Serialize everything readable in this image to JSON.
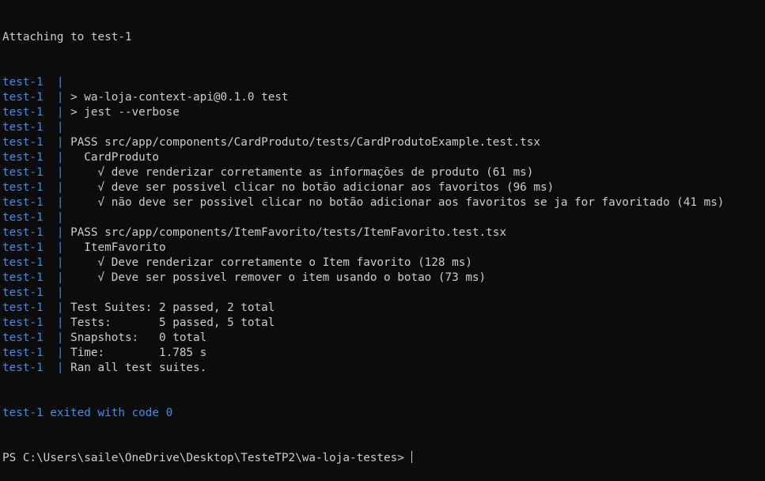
{
  "terminal": {
    "attach_line": "Attaching to test-1",
    "prefix": "test-1",
    "separator": "|",
    "lines": [
      "",
      "> wa-loja-context-api@0.1.0 test",
      "> jest --verbose",
      "",
      "PASS src/app/components/CardProduto/tests/CardProdutoExample.test.tsx",
      "  CardProduto",
      "    √ deve renderizar corretamente as informações de produto (61 ms)",
      "    √ deve ser possivel clicar no botão adicionar aos favoritos (96 ms)",
      "    √ não deve ser possivel clicar no botão adicionar aos favoritos se ja for favoritado (41 ms)",
      "",
      "PASS src/app/components/ItemFavorito/tests/ItemFavorito.test.tsx",
      "  ItemFavorito",
      "    √ Deve renderizar corretamente o Item favorito (128 ms)",
      "    √ Deve ser possivel remover o item usando o botao (73 ms)",
      "",
      "Test Suites: 2 passed, 2 total",
      "Tests:       5 passed, 5 total",
      "Snapshots:   0 total",
      "Time:        1.785 s",
      "Ran all test suites."
    ],
    "exit_line": "test-1 exited with code 0",
    "prompt": "PS C:\\Users\\saile\\OneDrive\\Desktop\\TesteTP2\\wa-loja-testes> ",
    "colors": {
      "background": "#0c0c0c",
      "foreground": "#cccccc",
      "prefix": "#3b8eea"
    }
  }
}
